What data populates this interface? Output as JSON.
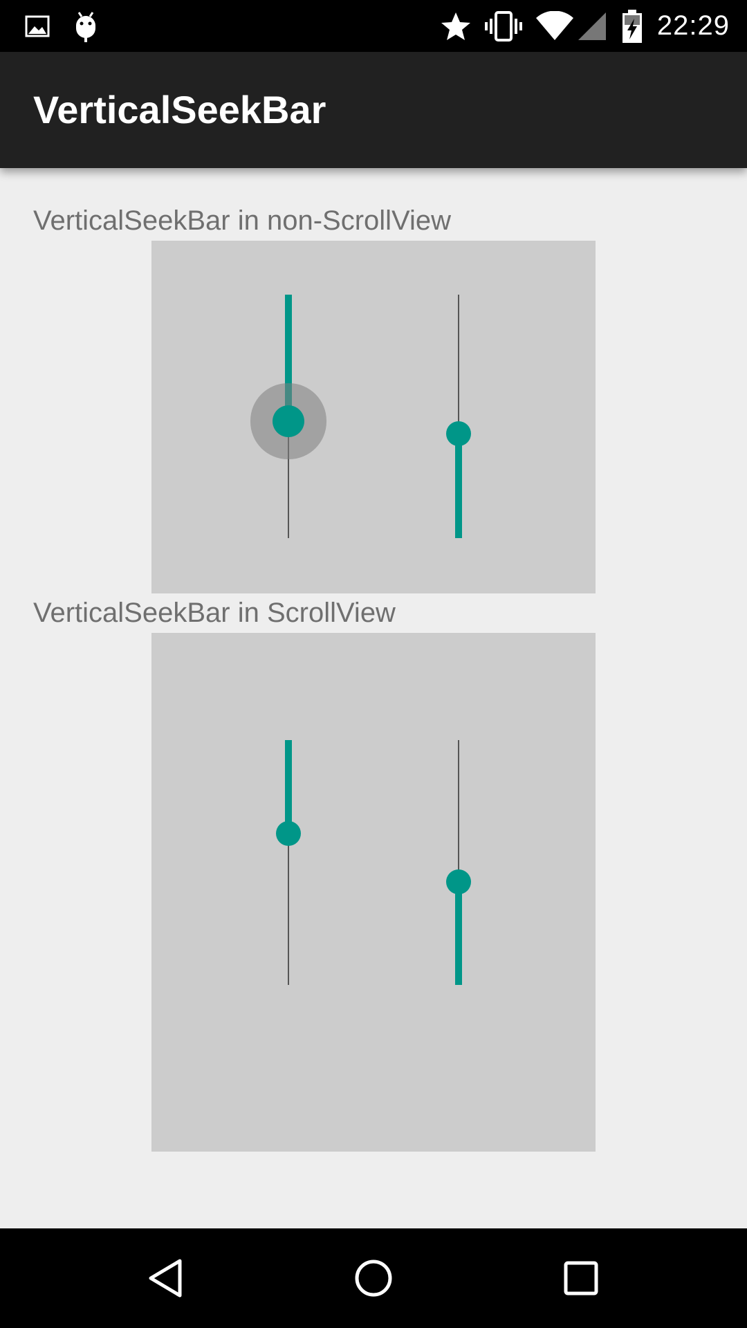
{
  "status_bar": {
    "time": "22:29",
    "left_icons": [
      "image-notification-icon",
      "android-debug-icon"
    ],
    "right_icons": [
      "star-icon",
      "vibrate-icon",
      "wifi-icon",
      "signal-icon",
      "battery-charging-icon"
    ]
  },
  "toolbar": {
    "title": "VerticalSeekBar"
  },
  "sections": [
    {
      "label": "VerticalSeekBar in non-ScrollView",
      "seekbars": [
        {
          "name": "seekbar-1",
          "progress": 0.52,
          "fill_from": "top",
          "pressed": true
        },
        {
          "name": "seekbar-2",
          "progress": 0.43,
          "fill_from": "bottom",
          "pressed": false
        }
      ]
    },
    {
      "label": "VerticalSeekBar in ScrollView",
      "seekbars": [
        {
          "name": "seekbar-3",
          "progress": 0.38,
          "fill_from": "top",
          "pressed": false
        },
        {
          "name": "seekbar-4",
          "progress": 0.42,
          "fill_from": "bottom",
          "pressed": false
        }
      ]
    }
  ],
  "colors": {
    "accent": "#009688",
    "toolbar": "#212121",
    "background": "#eeeeee",
    "panel": "#cccccc"
  },
  "nav_bar": {
    "icons": [
      "back-icon",
      "home-icon",
      "recents-icon"
    ]
  }
}
